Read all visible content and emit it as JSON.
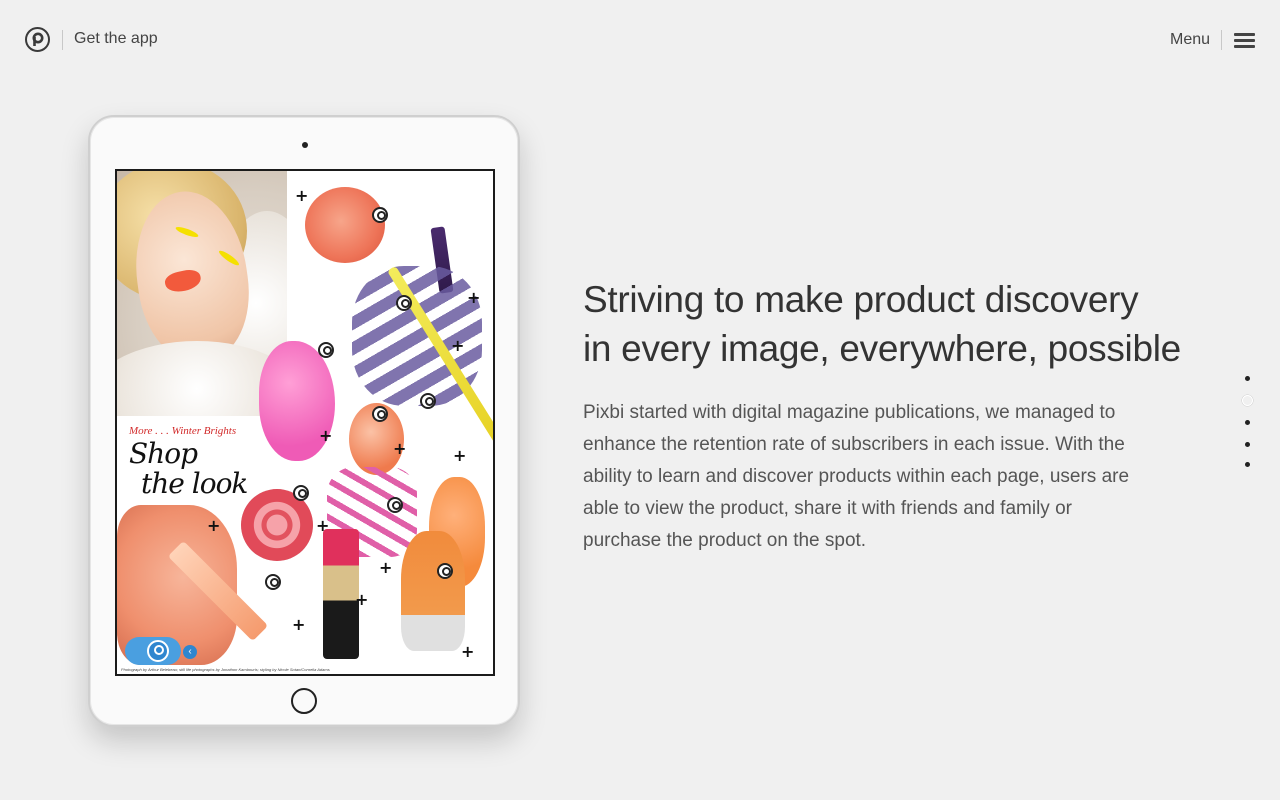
{
  "header": {
    "get_app_label": "Get the app",
    "menu_label": "Menu"
  },
  "magazine": {
    "kicker": "More . . . Winter Brights",
    "title_line1": "Shop",
    "title_line2": "the look",
    "credits": "Photograph by Arthur Belebeau; still life photographs by Jonathon Kambouris; styling by Nicole Sotan/Cornelia Adams"
  },
  "hero": {
    "headline_line1": "Striving to make product discovery",
    "headline_line2": "in every image, everywhere, possible",
    "body_lines": [
      "Pixbi started with digital magazine publications, we managed to",
      "enhance the retention rate of subscribers in each issue. With the",
      "ability to learn and discover products within each page, users are",
      "able to view the product, share it with friends and family or",
      "purchase the product on the spot."
    ]
  },
  "section_nav": {
    "count": 5,
    "active_index": 1
  },
  "colors": {
    "background": "#f0f0f0",
    "pixbi_blue": "#4a9fe0",
    "kicker_red": "#d22a2a"
  }
}
